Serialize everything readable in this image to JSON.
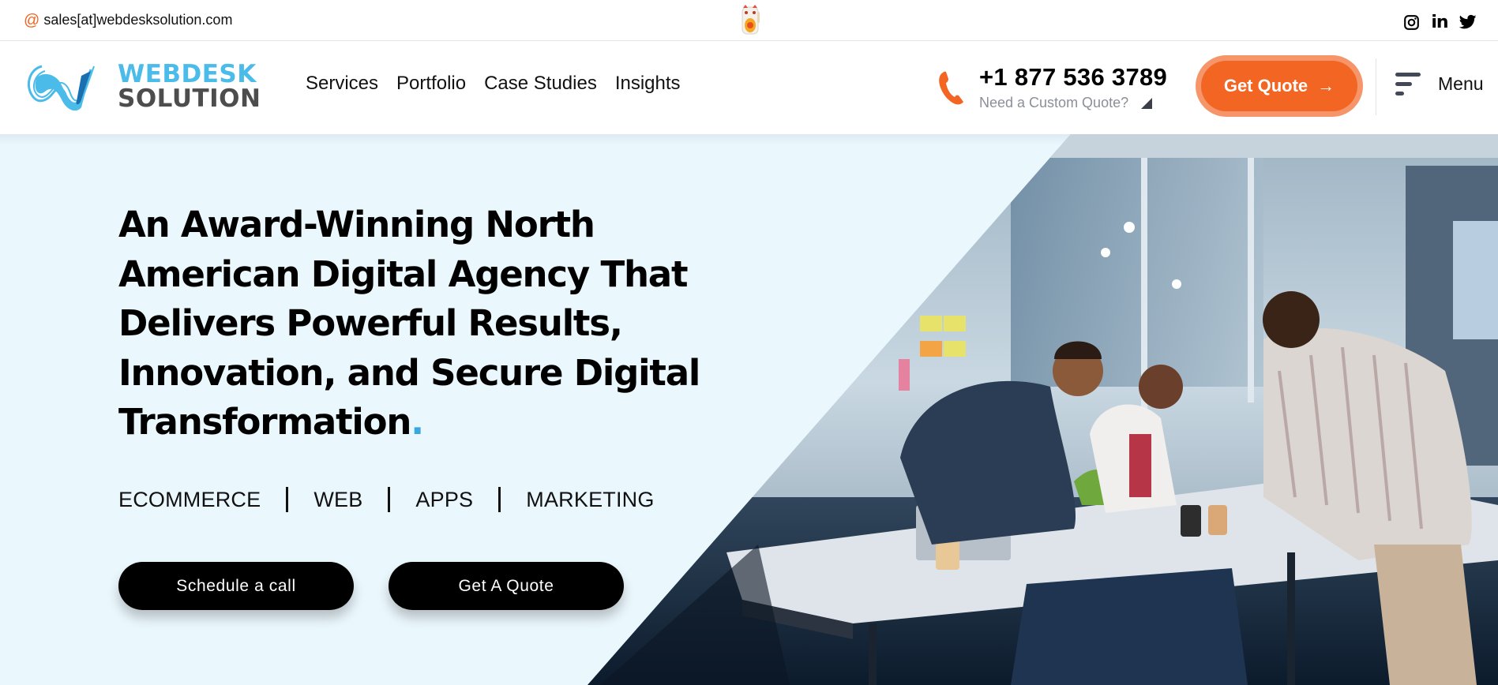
{
  "topbar": {
    "email": "sales[at]webdesksolution.com",
    "email_icon": "at-icon",
    "mascot_icon": "lucky-cat-icon",
    "socials": [
      {
        "name": "instagram",
        "icon": "instagram-icon"
      },
      {
        "name": "linkedin",
        "icon": "linkedin-icon",
        "glyph": "in"
      },
      {
        "name": "twitter",
        "icon": "twitter-icon"
      }
    ]
  },
  "brand": {
    "line1": "WEBDESK",
    "line2": "SOLUTION",
    "colors": {
      "primary": "#4bbbe9",
      "secondary": "#4d4d4d",
      "accent": "#f26522"
    }
  },
  "nav": {
    "links": [
      "Services",
      "Portfolio",
      "Case Studies",
      "Insights"
    ]
  },
  "contact": {
    "phone": "+1 877 536 3789",
    "subtitle": "Need a Custom Quote?"
  },
  "header_cta": {
    "label": "Get Quote",
    "arrow": "→"
  },
  "menu": {
    "label": "Menu"
  },
  "hero": {
    "headline": "An Award-Winning North American Digital Agency That Delivers Powerful Results, Innovation, and Secure Digital Transformation",
    "headline_dot": ".",
    "tags": [
      "ECOMMERCE",
      "WEB",
      "APPS",
      "MARKETING"
    ],
    "buttons": {
      "primary": "Schedule a call",
      "secondary": "Get A Quote"
    },
    "image_alt": "Team collaborating around an office table"
  }
}
